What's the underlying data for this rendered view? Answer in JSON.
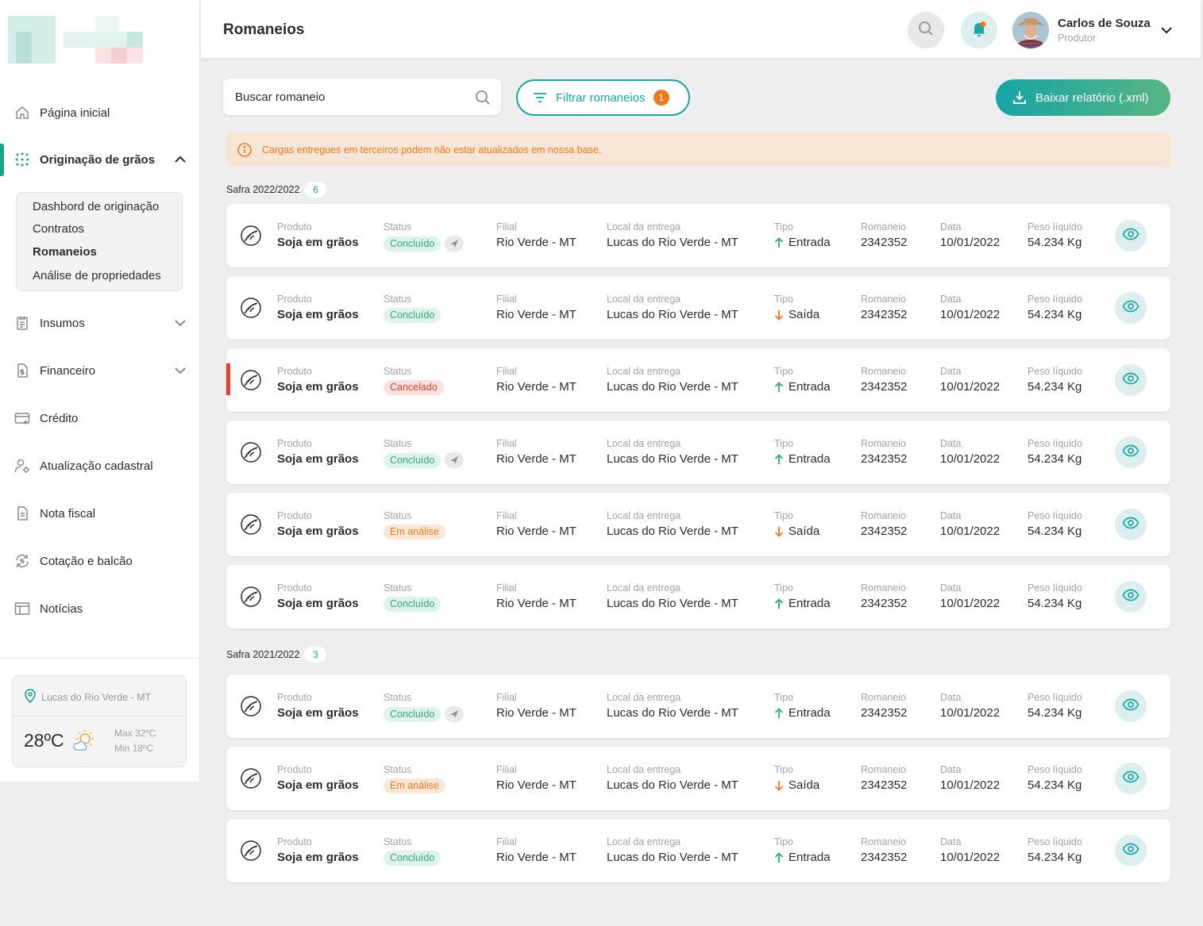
{
  "header": {
    "title": "Romaneios",
    "user_name": "Carlos de Souza",
    "user_role": "Produtor"
  },
  "sidebar": {
    "items": [
      {
        "label": "Página inicial",
        "icon": "home-icon"
      },
      {
        "label": "Originação de grãos",
        "icon": "grain-dots-icon"
      },
      {
        "label": "Insumos",
        "icon": "clipboard-icon"
      },
      {
        "label": "Financeiro",
        "icon": "money-doc-icon"
      },
      {
        "label": "Crédito",
        "icon": "credit-card-icon"
      },
      {
        "label": "Atualização cadastral",
        "icon": "user-gear-icon"
      },
      {
        "label": "Nota fiscal",
        "icon": "invoice-icon"
      },
      {
        "label": "Cotação e balcão",
        "icon": "exchange-icon"
      },
      {
        "label": "Notícias",
        "icon": "news-icon"
      }
    ],
    "submenu": [
      "Dashbord de originação",
      "Contratos",
      "Romaneios",
      "Análise de propriedades"
    ],
    "weather": {
      "location": "Lucas do Rio Verde - MT",
      "temp": "28ºC",
      "max": "Max 32ºC",
      "min": "Min 18ºC"
    }
  },
  "toolbar": {
    "search_placeholder": "Buscar romaneio",
    "filter_label": "Filtrar romaneios",
    "filter_count": "1",
    "download_label": "Baixar relatório (.xml)"
  },
  "alert": "Cargas entregues em terceiros podem não estar atualizados em nossa base.",
  "labels": {
    "produto": "Produto",
    "status": "Status",
    "filial": "Filial",
    "local": "Local da entrega",
    "tipo": "Tipo",
    "romaneio": "Romaneio",
    "data": "Data",
    "peso": "Peso líquido"
  },
  "groups": [
    {
      "label": "Safra 2022/2022",
      "count": "6",
      "rows": [
        {
          "produto": "Soja em grãos",
          "status": "Concluído",
          "status_kind": "concluido",
          "truck": true,
          "filial": "Rio Verde - MT",
          "local": "Lucas do Rio Verde - MT",
          "tipo": "Entrada",
          "romaneio": "2342352",
          "data": "10/01/2022",
          "peso": "54.234 Kg",
          "flag": false
        },
        {
          "produto": "Soja em grãos",
          "status": "Concluído",
          "status_kind": "concluido",
          "truck": false,
          "filial": "Rio Verde - MT",
          "local": "Lucas do Rio Verde - MT",
          "tipo": "Saída",
          "romaneio": "2342352",
          "data": "10/01/2022",
          "peso": "54.234 Kg",
          "flag": false
        },
        {
          "produto": "Soja em grãos",
          "status": "Cancelado",
          "status_kind": "cancelado",
          "truck": false,
          "filial": "Rio Verde - MT",
          "local": "Lucas do Rio Verde - MT",
          "tipo": "Entrada",
          "romaneio": "2342352",
          "data": "10/01/2022",
          "peso": "54.234 Kg",
          "flag": true
        },
        {
          "produto": "Soja em grãos",
          "status": "Concluído",
          "status_kind": "concluido",
          "truck": true,
          "filial": "Rio Verde - MT",
          "local": "Lucas do Rio Verde - MT",
          "tipo": "Entrada",
          "romaneio": "2342352",
          "data": "10/01/2022",
          "peso": "54.234 Kg",
          "flag": false
        },
        {
          "produto": "Soja em grãos",
          "status": "Em análise",
          "status_kind": "analise",
          "truck": false,
          "filial": "Rio Verde - MT",
          "local": "Lucas do Rio Verde - MT",
          "tipo": "Saída",
          "romaneio": "2342352",
          "data": "10/01/2022",
          "peso": "54.234 Kg",
          "flag": false
        },
        {
          "produto": "Soja em grãos",
          "status": "Concluído",
          "status_kind": "concluido",
          "truck": false,
          "filial": "Rio Verde - MT",
          "local": "Lucas do Rio Verde - MT",
          "tipo": "Entrada",
          "romaneio": "2342352",
          "data": "10/01/2022",
          "peso": "54.234 Kg",
          "flag": false
        }
      ]
    },
    {
      "label": "Safra 2021/2022",
      "count": "3",
      "rows": [
        {
          "produto": "Soja em grãos",
          "status": "Concluído",
          "status_kind": "concluido",
          "truck": true,
          "filial": "Rio Verde - MT",
          "local": "Lucas do Rio Verde - MT",
          "tipo": "Entrada",
          "romaneio": "2342352",
          "data": "10/01/2022",
          "peso": "54.234 Kg",
          "flag": false
        },
        {
          "produto": "Soja em grãos",
          "status": "Em análise",
          "status_kind": "analise",
          "truck": false,
          "filial": "Rio Verde - MT",
          "local": "Lucas do Rio Verde - MT",
          "tipo": "Saída",
          "romaneio": "2342352",
          "data": "10/01/2022",
          "peso": "54.234 Kg",
          "flag": false
        },
        {
          "produto": "Soja em grãos",
          "status": "Concluído",
          "status_kind": "concluido",
          "truck": false,
          "filial": "Rio Verde - MT",
          "local": "Lucas do Rio Verde - MT",
          "tipo": "Entrada",
          "romaneio": "2342352",
          "data": "10/01/2022",
          "peso": "54.234 Kg",
          "flag": false
        }
      ]
    }
  ],
  "colors": {
    "accent": "#18a8a3",
    "active": "#16a38b",
    "warning": "#ef7a1a",
    "danger": "#e2412c",
    "success": "#2ea97b"
  }
}
